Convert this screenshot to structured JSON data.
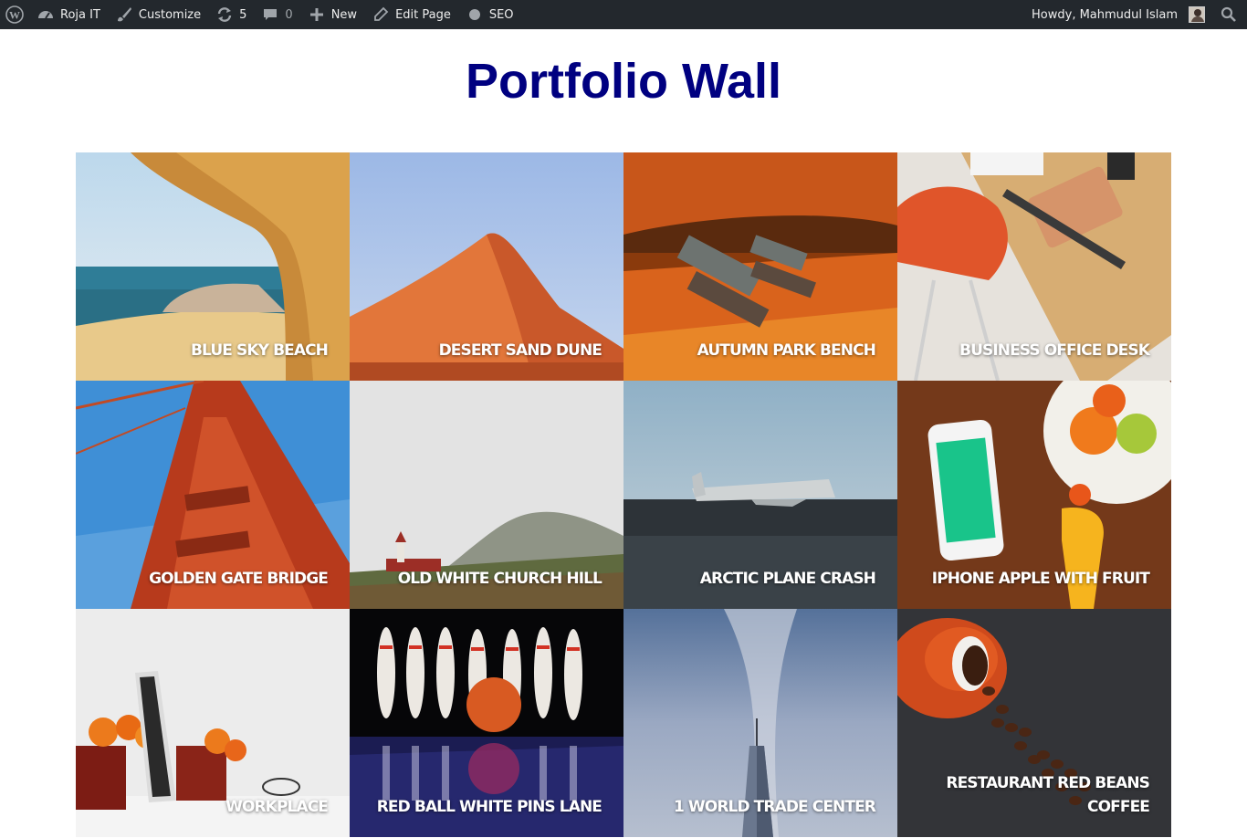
{
  "admin_bar": {
    "site_name": "Roja IT",
    "customize": "Customize",
    "updates_count": "5",
    "comments_count": "0",
    "new": "New",
    "edit_page": "Edit Page",
    "seo": "SEO",
    "greeting": "Howdy, Mahmudul Islam",
    "icons": [
      "wordpress-logo-icon",
      "dashboard-icon",
      "brush-icon",
      "update-icon",
      "comment-icon",
      "plus-icon",
      "pencil-icon",
      "seo-dot-icon",
      "avatar",
      "search-icon"
    ],
    "colors": {
      "bar": "#23282d",
      "text": "#eeeeee",
      "muted": "#a0a5aa"
    }
  },
  "page": {
    "title": "Portfolio Wall",
    "title_color": "#000080"
  },
  "portfolio": {
    "items": [
      {
        "caption": "Blue Sky Beach"
      },
      {
        "caption": "Desert Sand Dune"
      },
      {
        "caption": "Autumn Park Bench"
      },
      {
        "caption": "Business Office Desk"
      },
      {
        "caption": "Golden Gate Bridge"
      },
      {
        "caption": "Old White Church Hill"
      },
      {
        "caption": "Arctic Plane Crash"
      },
      {
        "caption": "iPhone Apple With Fruit"
      },
      {
        "caption": "Workplace"
      },
      {
        "caption": "Red Ball White Pins Lane"
      },
      {
        "caption": "1 World Trade Center"
      },
      {
        "caption": "Restaurant Red Beans Coffee"
      }
    ]
  }
}
